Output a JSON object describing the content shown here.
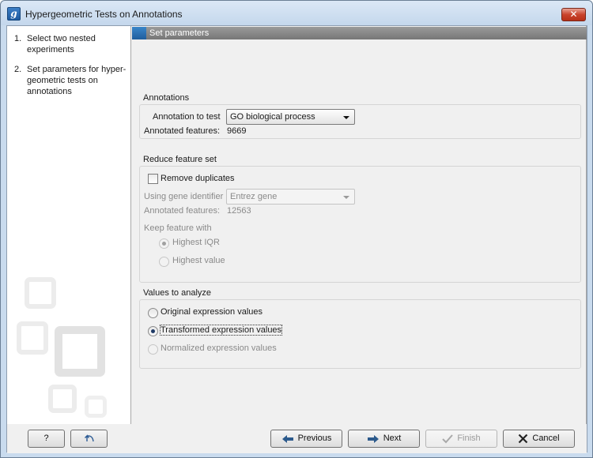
{
  "window": {
    "title": "Hypergeometric Tests on Annotations",
    "app_icon_glyph": "g",
    "close_glyph": "✕"
  },
  "steps": [
    {
      "number": "1.",
      "label": "Select two nested experiments"
    },
    {
      "number": "2.",
      "label": "Set parameters for hyper-geometric tests on annotations"
    }
  ],
  "header": {
    "title": "Set parameters"
  },
  "annotations": {
    "title": "Annotations",
    "annotation_label": "Annotation to test",
    "annotation_value": "GO biological process",
    "annotated_label": "Annotated features:",
    "annotated_value": "9669"
  },
  "reduce": {
    "title": "Reduce feature set",
    "remove_duplicates_label": "Remove duplicates",
    "remove_duplicates_checked": false,
    "gene_identifier_label": "Using gene identifier",
    "gene_identifier_value": "Entrez gene",
    "annotated_label": "Annotated features:",
    "annotated_value": "12563",
    "keep_label": "Keep feature with",
    "keep_options": [
      "Highest IQR",
      "Highest value"
    ],
    "keep_selected": "Highest IQR"
  },
  "values": {
    "title": "Values to analyze",
    "options": [
      "Original expression values",
      "Transformed expression values",
      "Normalized expression values"
    ],
    "selected": "Transformed expression values"
  },
  "footer": {
    "help_label": "?",
    "previous_label": "Previous",
    "next_label": "Next",
    "finish_label": "Finish",
    "cancel_label": "Cancel"
  },
  "colors": {
    "header_marker": "#2f77bd",
    "close_button": "#c9432c",
    "title_bar": "#c9dbee"
  },
  "icons": {
    "app": "app-logo-icon",
    "close": "close-icon",
    "undo": "undo-arrow-icon",
    "previous": "arrow-left-icon",
    "next": "arrow-right-icon",
    "finish": "checkmark-icon",
    "cancel": "x-icon"
  }
}
